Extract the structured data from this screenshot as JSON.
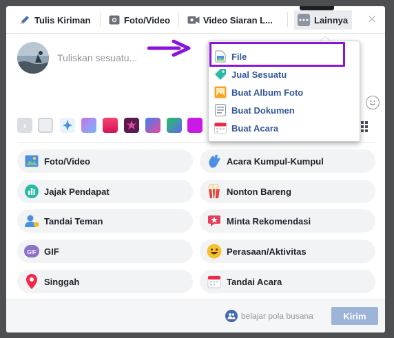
{
  "tabs": [
    {
      "label": "Tulis Kiriman",
      "icon": "pencil-icon"
    },
    {
      "label": "Foto/Video",
      "icon": "camera-icon"
    },
    {
      "label": "Video Siaran L...",
      "icon": "video-camera-icon"
    }
  ],
  "more_tab": {
    "label": "Lainnya",
    "icon": "more-dots-icon"
  },
  "composer": {
    "placeholder": "Tuliskan sesuatu..."
  },
  "dropdown": {
    "items": [
      {
        "label": "File",
        "icon": "file-icon"
      },
      {
        "label": "Jual Sesuatu",
        "icon": "price-tag-icon"
      },
      {
        "label": "Buat Album Foto",
        "icon": "photo-album-icon"
      },
      {
        "label": "Buat Dokumen",
        "icon": "document-icon"
      },
      {
        "label": "Buat Acara",
        "icon": "calendar-icon"
      }
    ]
  },
  "actions": {
    "left": [
      {
        "label": "Foto/Video",
        "icon": "photo-icon"
      },
      {
        "label": "Jajak Pendapat",
        "icon": "poll-icon"
      },
      {
        "label": "Tandai Teman",
        "icon": "tag-friend-icon"
      },
      {
        "label": "GIF",
        "icon": "gif-icon"
      },
      {
        "label": "Singgah",
        "icon": "location-pin-icon"
      }
    ],
    "right": [
      {
        "label": "Acara Kumpul-Kumpul",
        "icon": "hand-wave-icon"
      },
      {
        "label": "Nonton Bareng",
        "icon": "popcorn-icon"
      },
      {
        "label": "Minta Rekomendasi",
        "icon": "recommendation-icon"
      },
      {
        "label": "Perasaan/Aktivitas",
        "icon": "smiley-icon"
      },
      {
        "label": "Tandai Acara",
        "icon": "calendar-icon"
      }
    ]
  },
  "footer": {
    "audience_label": "belajar pola busana",
    "send_label": "Kirim"
  },
  "colors": {
    "accent": "#365899",
    "highlight": "#8a15d6",
    "send_disabled": "#9cb4d8"
  }
}
